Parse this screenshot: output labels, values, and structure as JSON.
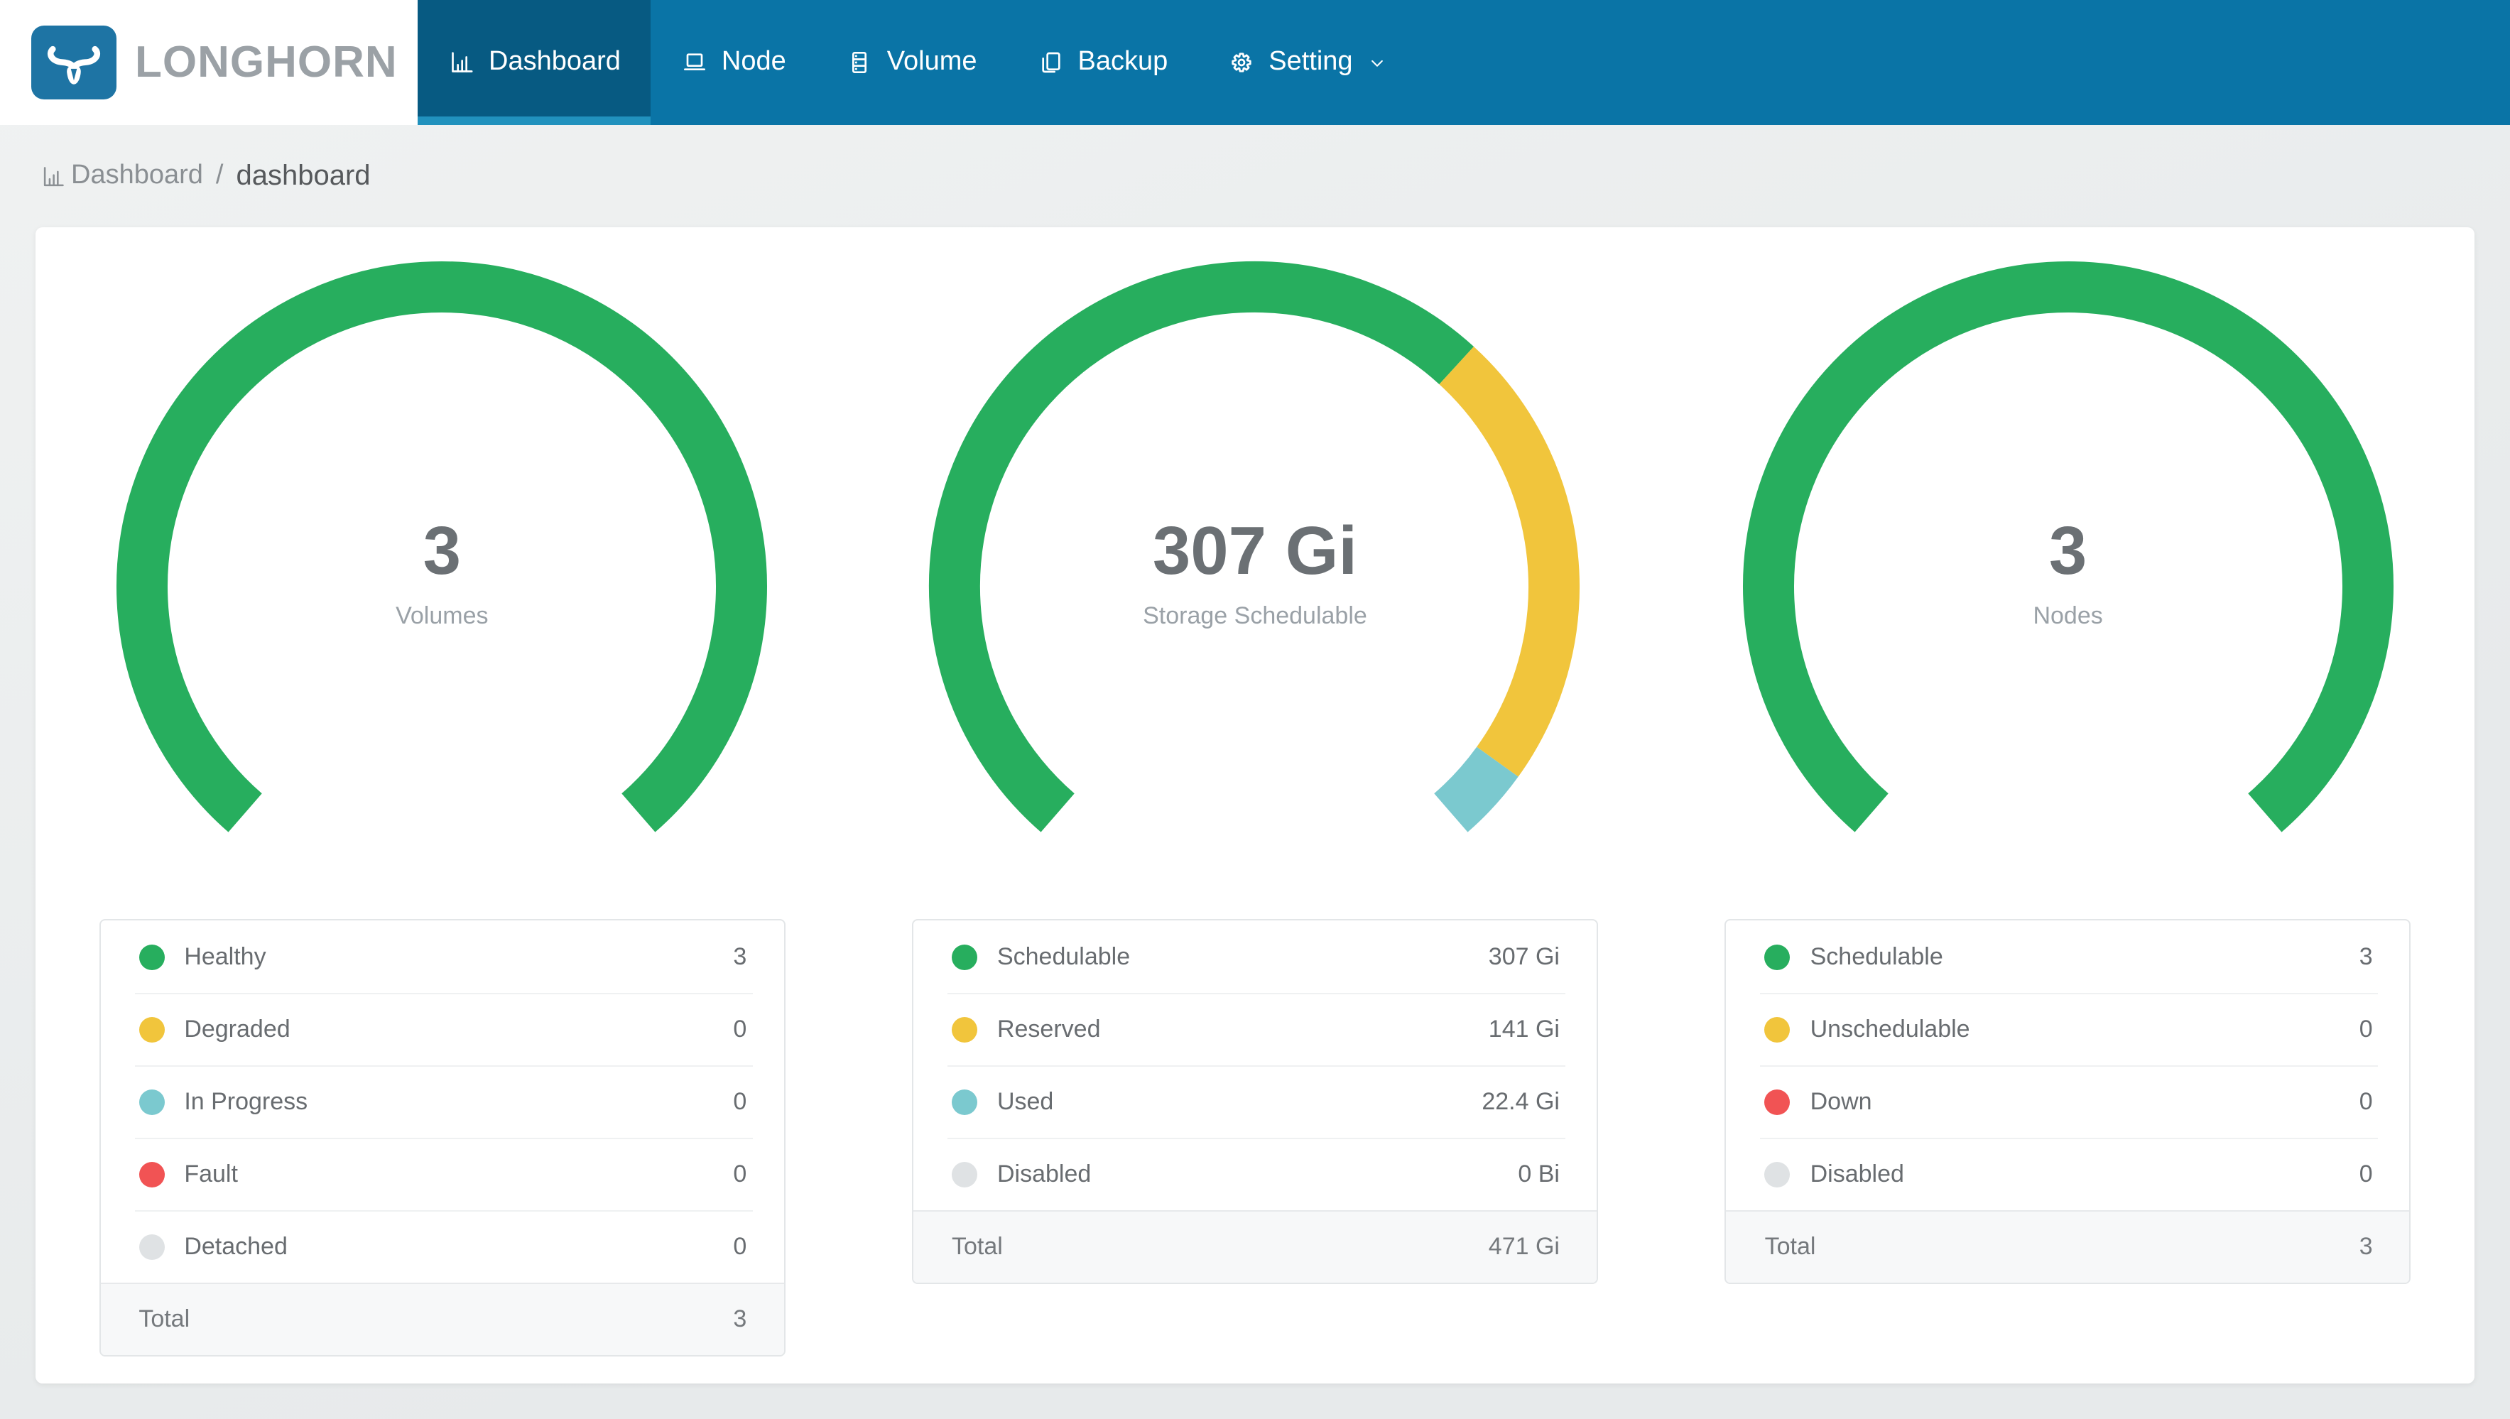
{
  "header": {
    "brand": "LONGHORN",
    "tabs": [
      {
        "label": "Dashboard",
        "icon": "dashboard-chart-icon",
        "active": true
      },
      {
        "label": "Node",
        "icon": "node-icon",
        "active": false
      },
      {
        "label": "Volume",
        "icon": "volume-icon",
        "active": false
      },
      {
        "label": "Backup",
        "icon": "backup-icon",
        "active": false
      },
      {
        "label": "Setting",
        "icon": "setting-gear-icon",
        "active": false,
        "caret": "caret-down-icon"
      }
    ],
    "colors": {
      "nav_bg": "#0a74a6",
      "active_tab_bg": "#075a82",
      "active_tab_underline": "#2191bd",
      "logo_blue": "#1e74a4",
      "brand_text": "#9ba1a6"
    }
  },
  "breadcrumb": {
    "icon": "bar-chart-icon",
    "section": "Dashboard",
    "separator": "/",
    "page": "dashboard"
  },
  "chart_data": [
    {
      "type": "gauge-donut",
      "center_value": "3",
      "center_label": "Volumes",
      "start_bearing_deg": 221,
      "sweep_deg": 278,
      "segments": [
        {
          "label": "Healthy",
          "value": 3,
          "display": "3",
          "color": "#27ae5e"
        },
        {
          "label": "Degraded",
          "value": 0,
          "display": "0",
          "color": "#f1c53c"
        },
        {
          "label": "In Progress",
          "value": 0,
          "display": "0",
          "color": "#7bc9cf"
        },
        {
          "label": "Fault",
          "value": 0,
          "display": "0",
          "color": "#f15354"
        },
        {
          "label": "Detached",
          "value": 0,
          "display": "0",
          "color": "#dfe2e4"
        }
      ],
      "total": {
        "label": "Total",
        "value": 3,
        "display": "3"
      }
    },
    {
      "type": "gauge-donut",
      "center_value": "307 Gi",
      "center_label": "Storage Schedulable",
      "start_bearing_deg": 221,
      "sweep_deg": 278,
      "segments": [
        {
          "label": "Schedulable",
          "value": 307,
          "display": "307 Gi",
          "color": "#27ae5e"
        },
        {
          "label": "Reserved",
          "value": 141,
          "display": "141 Gi",
          "color": "#f1c53c"
        },
        {
          "label": "Used",
          "value": 22.4,
          "display": "22.4 Gi",
          "color": "#7bc9cf"
        },
        {
          "label": "Disabled",
          "value": 0,
          "display": "0 Bi",
          "color": "#dfe2e4"
        }
      ],
      "total": {
        "label": "Total",
        "value": 470.4,
        "display": "471 Gi"
      }
    },
    {
      "type": "gauge-donut",
      "center_value": "3",
      "center_label": "Nodes",
      "start_bearing_deg": 221,
      "sweep_deg": 278,
      "segments": [
        {
          "label": "Schedulable",
          "value": 3,
          "display": "3",
          "color": "#27ae5e"
        },
        {
          "label": "Unschedulable",
          "value": 0,
          "display": "0",
          "color": "#f1c53c"
        },
        {
          "label": "Down",
          "value": 0,
          "display": "0",
          "color": "#f15354"
        },
        {
          "label": "Disabled",
          "value": 0,
          "display": "0",
          "color": "#dfe2e4"
        }
      ],
      "total": {
        "label": "Total",
        "value": 3,
        "display": "3"
      }
    }
  ]
}
